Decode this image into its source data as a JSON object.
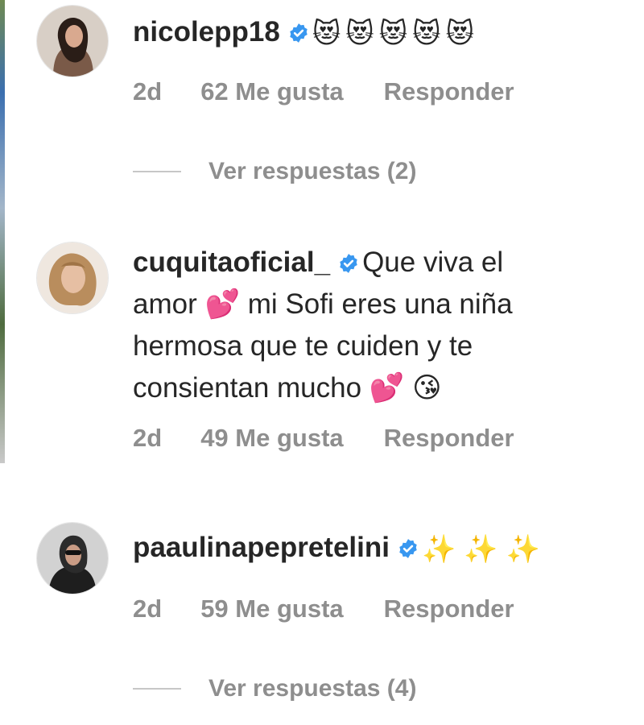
{
  "comments": [
    {
      "username": "nicolepp18",
      "text_lines": [],
      "emojis": "😻😻😻😻😻",
      "time": "2d",
      "likes": "62 Me gusta",
      "reply": "Responder",
      "view_replies": "Ver respuestas (2)"
    },
    {
      "username": "cuquitaoficial_",
      "first_text": "Que viva el",
      "line2": "amor 💕 mi Sofi eres una niña",
      "line3": "hermosa que te cuiden y te",
      "line4": "consientan mucho 💕 😘",
      "time": "2d",
      "likes": "49 Me gusta",
      "reply": "Responder"
    },
    {
      "username": "paaulinapepretelini",
      "emojis": "✨✨✨",
      "time": "2d",
      "likes": "59 Me gusta",
      "reply": "Responder",
      "view_replies": "Ver respuestas (4)"
    }
  ],
  "colors": {
    "verified": "#3897f0",
    "muted": "#8e8e8e",
    "text": "#262626"
  }
}
